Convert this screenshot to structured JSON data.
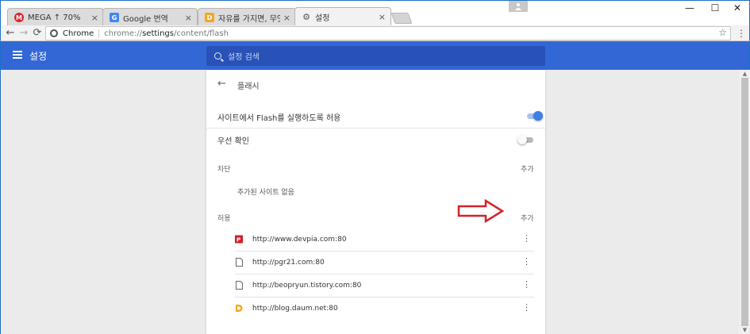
{
  "window": {
    "profile_icon": "user-icon",
    "minimize": "—",
    "maximize": "☐",
    "close": "✕"
  },
  "tabs": [
    {
      "title": "MEGA ↑ 70%",
      "favicon": "mega-icon",
      "favicon_glyph": "M",
      "favicon_color": "#d9272e",
      "close": "×",
      "active": false
    },
    {
      "title": "Google 번역",
      "favicon": "google-translate-icon",
      "favicon_glyph": "G",
      "favicon_color": "#4285f4",
      "close": "×",
      "active": false
    },
    {
      "title": "자유를 가지면, 무엇을 ·",
      "favicon": "blog-icon",
      "favicon_glyph": "D",
      "favicon_color": "#f5a623",
      "close": "×",
      "active": false
    },
    {
      "title": "설정",
      "favicon": "gear-icon",
      "favicon_glyph": "⚙",
      "favicon_color": "#555555",
      "close": "×",
      "active": true
    }
  ],
  "toolbar": {
    "back": "←",
    "forward": "→",
    "reload": "⟳",
    "chip_label": "Chrome",
    "url_scheme": "chrome://",
    "url_host": "settings",
    "url_path": "/content/flash",
    "star": "☆",
    "menu": "⋮"
  },
  "settings_header": {
    "title": "설정",
    "search_placeholder": "설정 검색",
    "accent_color": "#3367d6"
  },
  "flash_page": {
    "title": "플래시",
    "allow_flash_label": "사이트에서 Flash를 실행하도록 허용",
    "allow_flash_on": true,
    "ask_first_label": "우선 확인",
    "ask_first_on": false,
    "block_section": {
      "label": "차단",
      "add_label": "추가",
      "empty_text": "추가된 사이트 없음"
    },
    "allow_section": {
      "label": "허용",
      "add_label": "추가",
      "sites": [
        {
          "url": "http://www.devpia.com:80",
          "icon": "devpia-icon"
        },
        {
          "url": "http://pgr21.com:80",
          "icon": "page-icon"
        },
        {
          "url": "http://beopryun.tistory.com:80",
          "icon": "page-icon"
        },
        {
          "url": "http://blog.daum.net:80",
          "icon": "daum-icon"
        }
      ],
      "more_glyph": "⋮"
    }
  },
  "annotation": {
    "arrow_color": "#d0262a"
  },
  "scrollbar": {
    "up": "▲",
    "down": "▼"
  }
}
